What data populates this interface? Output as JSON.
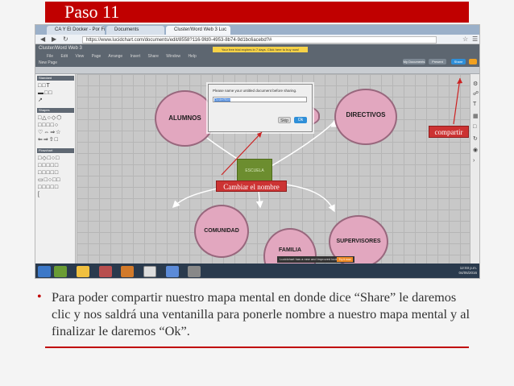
{
  "slide": {
    "title": "Paso 11",
    "bullet": "Para poder compartir nuestro mapa mental en donde dice “Share” le daremos clic y nos saldrá una ventanilla para ponerle nombre a nuestro mapa mental y al finalizar le daremos “Ok”.",
    "accent_color": "#c00000"
  },
  "browser": {
    "tabs": [
      "CA Y El Docker - Por Fil",
      "Documents",
      "Cluster/Word Web 3 Luc"
    ],
    "url": "https://www.lucidchart.com/documents/edit/8558?116-9fd0-4953-8b74-9d1bc6acebd?#",
    "nav_icons": [
      "back-icon",
      "forward-icon",
      "refresh-icon"
    ]
  },
  "app": {
    "name": "Cluster/Word Web 3",
    "menu": [
      "File",
      "Edit",
      "View",
      "Page",
      "Arrange",
      "Insert",
      "Share",
      "Window",
      "Help"
    ],
    "page_tab": "New Page",
    "banner": "Your free trial expires in 7 days. Click here to buy now!",
    "buttons": {
      "documents": "My Documents",
      "presentation": "Present",
      "share": "Share"
    }
  },
  "left_panel": {
    "sections": [
      "Standard",
      "Shapes",
      "Flowchart"
    ]
  },
  "mindmap": {
    "nodes": [
      "ALUMNOS",
      "DIRECTIVOS",
      "COMUNIDAD",
      "FAMILIA",
      "SUPERVISORES"
    ],
    "center": "ESCUELA"
  },
  "dialog": {
    "prompt": "Please name your untitled document before sharing.",
    "input_value": "Cluster/Word Web",
    "skip_label": "Skip",
    "ok_label": "Ok"
  },
  "callouts": {
    "share": "compartir",
    "rename": "Cambiar el nombre"
  },
  "taskbar": {
    "toast": "Lucidchart has a new and improved look.",
    "toast_button": "Try it now",
    "time": "12:03 p.m.",
    "date": "04/05/2016"
  }
}
